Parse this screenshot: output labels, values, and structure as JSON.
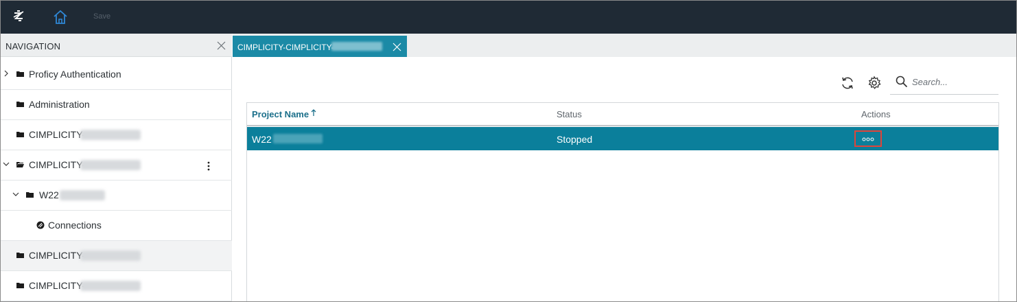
{
  "topbar": {
    "save_label": "Save",
    "icons": [
      "app-logo-icon",
      "home-icon"
    ]
  },
  "navigation": {
    "title": "NAVIGATION",
    "items": [
      {
        "label": "Proficy Authentication",
        "icon": "folder-icon",
        "expander": "chevron-right"
      },
      {
        "label": "Administration",
        "icon": "folder-icon"
      },
      {
        "label": "CIMPLICITY-",
        "icon": "folder-icon"
      },
      {
        "label": "CIMPLICITY-",
        "icon": "folder-open-icon",
        "expander": "chevron-down",
        "has_menu": true
      },
      {
        "label": "W22",
        "icon": "folder-icon",
        "expander": "chevron-down"
      },
      {
        "label": "Connections",
        "icon": "connections-icon"
      },
      {
        "label": "CIMPLICITY-",
        "icon": "folder-icon",
        "highlighted": true
      },
      {
        "label": "CIMPLICITY-",
        "icon": "folder-icon"
      }
    ]
  },
  "tabs": [
    {
      "label": "CIMPLICITY-CIMPLICITY-",
      "active": true
    }
  ],
  "toolbar": {
    "icons": [
      "refresh-icon",
      "settings-icon"
    ],
    "search_placeholder": "Search..."
  },
  "grid": {
    "columns": [
      "Project Name",
      "Status",
      "Actions"
    ],
    "sorted_column": "Project Name",
    "sort_direction": "ascending",
    "rows": [
      {
        "project_name": "W22",
        "status": "Stopped",
        "actions": "ooo"
      }
    ]
  },
  "colors": {
    "topbar": "#1f2a35",
    "tab_active": "#1b8aa6",
    "row_selected": "#0b7f9b",
    "highlight_box": "#e0443a",
    "sorted_header": "#1b6f8a"
  }
}
